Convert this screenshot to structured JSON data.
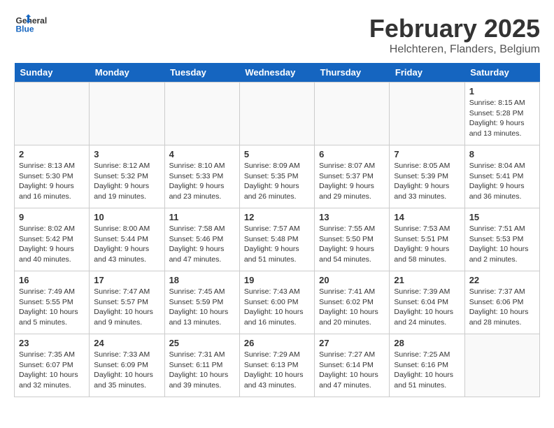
{
  "header": {
    "logo_top": "General",
    "logo_bottom": "Blue",
    "title": "February 2025",
    "subtitle": "Helchteren, Flanders, Belgium"
  },
  "days_of_week": [
    "Sunday",
    "Monday",
    "Tuesday",
    "Wednesday",
    "Thursday",
    "Friday",
    "Saturday"
  ],
  "weeks": [
    [
      {
        "day": "",
        "info": ""
      },
      {
        "day": "",
        "info": ""
      },
      {
        "day": "",
        "info": ""
      },
      {
        "day": "",
        "info": ""
      },
      {
        "day": "",
        "info": ""
      },
      {
        "day": "",
        "info": ""
      },
      {
        "day": "1",
        "info": "Sunrise: 8:15 AM\nSunset: 5:28 PM\nDaylight: 9 hours and 13 minutes."
      }
    ],
    [
      {
        "day": "2",
        "info": "Sunrise: 8:13 AM\nSunset: 5:30 PM\nDaylight: 9 hours and 16 minutes."
      },
      {
        "day": "3",
        "info": "Sunrise: 8:12 AM\nSunset: 5:32 PM\nDaylight: 9 hours and 19 minutes."
      },
      {
        "day": "4",
        "info": "Sunrise: 8:10 AM\nSunset: 5:33 PM\nDaylight: 9 hours and 23 minutes."
      },
      {
        "day": "5",
        "info": "Sunrise: 8:09 AM\nSunset: 5:35 PM\nDaylight: 9 hours and 26 minutes."
      },
      {
        "day": "6",
        "info": "Sunrise: 8:07 AM\nSunset: 5:37 PM\nDaylight: 9 hours and 29 minutes."
      },
      {
        "day": "7",
        "info": "Sunrise: 8:05 AM\nSunset: 5:39 PM\nDaylight: 9 hours and 33 minutes."
      },
      {
        "day": "8",
        "info": "Sunrise: 8:04 AM\nSunset: 5:41 PM\nDaylight: 9 hours and 36 minutes."
      }
    ],
    [
      {
        "day": "9",
        "info": "Sunrise: 8:02 AM\nSunset: 5:42 PM\nDaylight: 9 hours and 40 minutes."
      },
      {
        "day": "10",
        "info": "Sunrise: 8:00 AM\nSunset: 5:44 PM\nDaylight: 9 hours and 43 minutes."
      },
      {
        "day": "11",
        "info": "Sunrise: 7:58 AM\nSunset: 5:46 PM\nDaylight: 9 hours and 47 minutes."
      },
      {
        "day": "12",
        "info": "Sunrise: 7:57 AM\nSunset: 5:48 PM\nDaylight: 9 hours and 51 minutes."
      },
      {
        "day": "13",
        "info": "Sunrise: 7:55 AM\nSunset: 5:50 PM\nDaylight: 9 hours and 54 minutes."
      },
      {
        "day": "14",
        "info": "Sunrise: 7:53 AM\nSunset: 5:51 PM\nDaylight: 9 hours and 58 minutes."
      },
      {
        "day": "15",
        "info": "Sunrise: 7:51 AM\nSunset: 5:53 PM\nDaylight: 10 hours and 2 minutes."
      }
    ],
    [
      {
        "day": "16",
        "info": "Sunrise: 7:49 AM\nSunset: 5:55 PM\nDaylight: 10 hours and 5 minutes."
      },
      {
        "day": "17",
        "info": "Sunrise: 7:47 AM\nSunset: 5:57 PM\nDaylight: 10 hours and 9 minutes."
      },
      {
        "day": "18",
        "info": "Sunrise: 7:45 AM\nSunset: 5:59 PM\nDaylight: 10 hours and 13 minutes."
      },
      {
        "day": "19",
        "info": "Sunrise: 7:43 AM\nSunset: 6:00 PM\nDaylight: 10 hours and 16 minutes."
      },
      {
        "day": "20",
        "info": "Sunrise: 7:41 AM\nSunset: 6:02 PM\nDaylight: 10 hours and 20 minutes."
      },
      {
        "day": "21",
        "info": "Sunrise: 7:39 AM\nSunset: 6:04 PM\nDaylight: 10 hours and 24 minutes."
      },
      {
        "day": "22",
        "info": "Sunrise: 7:37 AM\nSunset: 6:06 PM\nDaylight: 10 hours and 28 minutes."
      }
    ],
    [
      {
        "day": "23",
        "info": "Sunrise: 7:35 AM\nSunset: 6:07 PM\nDaylight: 10 hours and 32 minutes."
      },
      {
        "day": "24",
        "info": "Sunrise: 7:33 AM\nSunset: 6:09 PM\nDaylight: 10 hours and 35 minutes."
      },
      {
        "day": "25",
        "info": "Sunrise: 7:31 AM\nSunset: 6:11 PM\nDaylight: 10 hours and 39 minutes."
      },
      {
        "day": "26",
        "info": "Sunrise: 7:29 AM\nSunset: 6:13 PM\nDaylight: 10 hours and 43 minutes."
      },
      {
        "day": "27",
        "info": "Sunrise: 7:27 AM\nSunset: 6:14 PM\nDaylight: 10 hours and 47 minutes."
      },
      {
        "day": "28",
        "info": "Sunrise: 7:25 AM\nSunset: 6:16 PM\nDaylight: 10 hours and 51 minutes."
      },
      {
        "day": "",
        "info": ""
      }
    ]
  ]
}
